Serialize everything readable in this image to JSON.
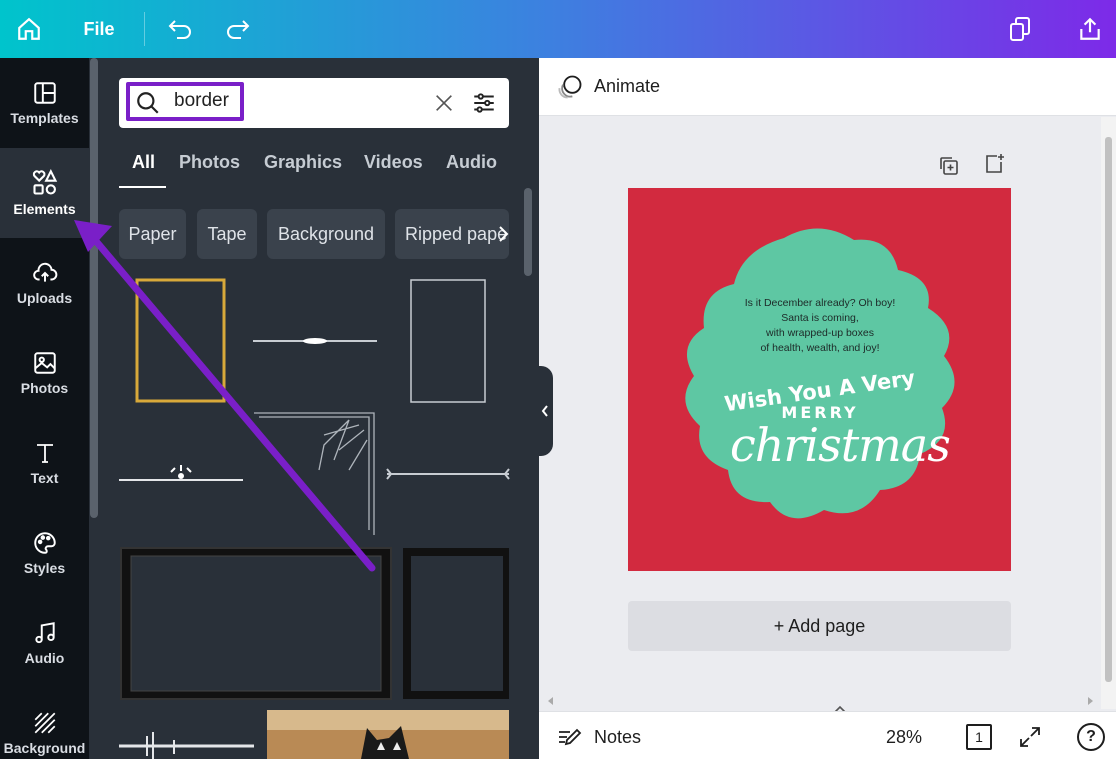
{
  "topbar": {
    "file_label": "File"
  },
  "rail": {
    "items": [
      {
        "label": "Templates",
        "icon": "templates-icon"
      },
      {
        "label": "Elements",
        "icon": "elements-icon"
      },
      {
        "label": "Uploads",
        "icon": "upload-cloud-icon"
      },
      {
        "label": "Photos",
        "icon": "photos-icon"
      },
      {
        "label": "Text",
        "icon": "text-icon"
      },
      {
        "label": "Styles",
        "icon": "palette-icon"
      },
      {
        "label": "Audio",
        "icon": "music-note-icon"
      },
      {
        "label": "Background",
        "icon": "background-icon"
      }
    ]
  },
  "search": {
    "value": "border"
  },
  "tabs": [
    "All",
    "Photos",
    "Graphics",
    "Videos",
    "Audio"
  ],
  "chips": [
    "Paper",
    "Tape",
    "Background",
    "Ripped pape"
  ],
  "editor": {
    "animate_label": "Animate",
    "add_page_label": "+ Add page",
    "notes_label": "Notes",
    "zoom": "28%",
    "page_number": "1",
    "help_label": "?"
  },
  "design": {
    "message_lines": [
      "Is it December already? Oh boy!",
      "Santa is coming,",
      "with wrapped-up boxes",
      "of health, wealth, and joy!"
    ],
    "wish_line1": "Wish You A Very",
    "wish_line2": "MERRY",
    "script": "christmas",
    "bg_color": "#d22a3f",
    "badge_color": "#5ec7a3"
  },
  "colors": {
    "annotation": "#7a1fc8",
    "panel": "#293039",
    "rail": "#0e1318"
  }
}
